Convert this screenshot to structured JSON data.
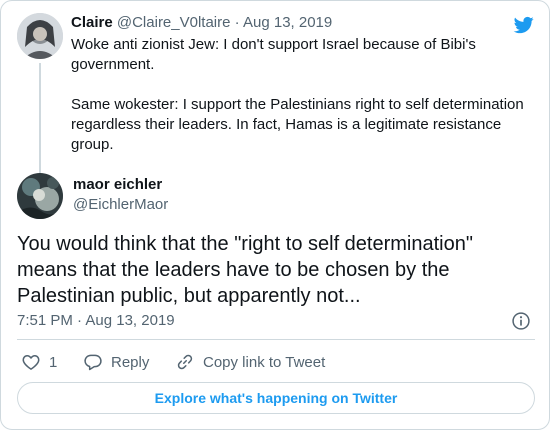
{
  "parent_tweet": {
    "display_name": "Claire",
    "handle": "@Claire_V0ltaire",
    "separator": "·",
    "date": "Aug 13, 2019",
    "paragraph1": "Woke anti zionist Jew: I don't support Israel because of Bibi's government.",
    "paragraph2": "Same wokester: I support the Palestinians right to self determination regardless their leaders. In fact, Hamas is a legitimate resistance group."
  },
  "main_tweet": {
    "display_name": "maor eichler",
    "handle": "@EichlerMaor",
    "text": "You would think that the \"right to self determination\" means that the leaders have to be chosen by the Palestinian public, but apparently not...",
    "time": "7:51 PM",
    "separator": "·",
    "date": "Aug 13, 2019"
  },
  "actions": {
    "like_count": "1",
    "reply_label": "Reply",
    "copy_label": "Copy link to Tweet"
  },
  "explore_label": "Explore what's happening on Twitter",
  "icons": {
    "brand": "twitter-bird-icon",
    "info": "info-icon",
    "like": "heart-icon",
    "reply": "reply-icon",
    "copy": "link-icon"
  },
  "colors": {
    "twitter_blue": "#1d9bf0",
    "muted_text": "#536471",
    "border": "#cfd9de"
  }
}
